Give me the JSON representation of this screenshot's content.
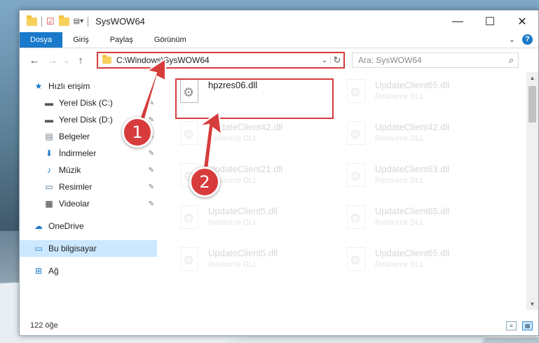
{
  "window": {
    "title": "SysWOW64",
    "caption": {
      "minimize": "—",
      "maximize": "☐",
      "close": "✕"
    }
  },
  "ribbon": {
    "tabs": [
      {
        "label": "Dosya"
      },
      {
        "label": "Giriş"
      },
      {
        "label": "Paylaş"
      },
      {
        "label": "Görünüm"
      }
    ],
    "expand_icon": "⌄",
    "help_label": "?"
  },
  "nav": {
    "back": "←",
    "forward": "→",
    "recent": "⌄",
    "up": "↑"
  },
  "address": {
    "path": "C:\\Windows\\SysWOW64",
    "dropdown": "⌄",
    "refresh": "↻"
  },
  "search": {
    "placeholder": "Ara: SysWOW64",
    "icon": "⌕"
  },
  "sidebar": {
    "items": [
      {
        "label": "Hızlı erişim",
        "icon": "star-icon",
        "glyph": "★",
        "color": "#1979ca"
      },
      {
        "label": "Yerel Disk (C:)",
        "icon": "drive-icon",
        "glyph": "▬",
        "color": "#555555",
        "pinned": true
      },
      {
        "label": "Yerel Disk (D:)",
        "icon": "drive-icon",
        "glyph": "▬",
        "color": "#555555",
        "pinned": true
      },
      {
        "label": "Belgeler",
        "icon": "documents-icon",
        "glyph": "▤",
        "color": "#6b7b8a",
        "pinned": true
      },
      {
        "label": "İndirmeler",
        "icon": "download-icon",
        "glyph": "⬇",
        "color": "#1979ca",
        "pinned": true
      },
      {
        "label": "Müzik",
        "icon": "music-icon",
        "glyph": "♪",
        "color": "#1979ca",
        "pinned": true
      },
      {
        "label": "Resimler",
        "icon": "pictures-icon",
        "glyph": "▭",
        "color": "#4a6a88",
        "pinned": true
      },
      {
        "label": "Videolar",
        "icon": "video-icon",
        "glyph": "▦",
        "color": "#333333",
        "pinned": true
      },
      {
        "label": "OneDrive",
        "icon": "cloud-icon",
        "glyph": "☁",
        "color": "#1979ca"
      },
      {
        "label": "Bu bilgisayar",
        "icon": "computer-icon",
        "glyph": "▭",
        "color": "#1979ca",
        "selected": true
      },
      {
        "label": "Ağ",
        "icon": "network-icon",
        "glyph": "⊞",
        "color": "#1979ca"
      }
    ],
    "pin_glyph": "📌"
  },
  "files": [
    {
      "name": "hpzres06.dll",
      "type": ""
    },
    {
      "name": "UpdateClient65.dll",
      "type": "Resource DLL"
    },
    {
      "name": "UpdateClient42.dll",
      "type": "Resource DLL"
    },
    {
      "name": "UpdateClient42.dll",
      "type": "Resource DLL"
    },
    {
      "name": "UpdateClient21.dll",
      "type": "Resource DLL"
    },
    {
      "name": "UpdateClient63.dll",
      "type": "Resource DLL"
    },
    {
      "name": "UpdateClient5.dll",
      "type": "Resource DLL"
    },
    {
      "name": "UpdateClient65.dll",
      "type": "Resource DLL"
    },
    {
      "name": "UpdateClient5.dll",
      "type": "Resource DLL"
    },
    {
      "name": "UpdateClient65.dll",
      "type": "Resource DLL"
    }
  ],
  "status": {
    "count": "122 öğe"
  },
  "annotations": {
    "badge1": "1",
    "badge2": "2",
    "accent": "#d73c3c"
  }
}
